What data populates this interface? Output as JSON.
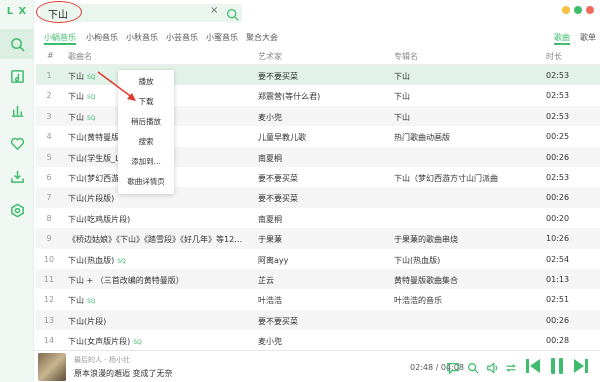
{
  "app": {
    "logo": "L X"
  },
  "search": {
    "query": "下山",
    "clear": "×"
  },
  "sources": [
    {
      "label": "小蜗音乐",
      "active": true
    },
    {
      "label": "小枸音乐",
      "active": false
    },
    {
      "label": "小秋音乐",
      "active": false
    },
    {
      "label": "小芸音乐",
      "active": false
    },
    {
      "label": "小蜜音乐",
      "active": false
    },
    {
      "label": "聚合大会",
      "active": false
    }
  ],
  "search_types": [
    {
      "label": "歌曲",
      "active": true
    },
    {
      "label": "歌单",
      "active": false
    }
  ],
  "table": {
    "headers": {
      "num": "#",
      "name": "歌曲名",
      "artist": "艺术家",
      "album": "专辑名",
      "time": "时长"
    },
    "rows": [
      {
        "num": "1",
        "name": "下山",
        "sq": "SQ",
        "artist": "要不要买菜",
        "album": "下山",
        "time": "02:53"
      },
      {
        "num": "2",
        "name": "下山",
        "sq": "SQ",
        "artist": "郑震营(等什么君)",
        "album": "下山",
        "time": "02:53"
      },
      {
        "num": "3",
        "name": "下山",
        "sq": "SQ",
        "artist": "麦小兜",
        "album": "下山",
        "time": "02:53"
      },
      {
        "num": "4",
        "name": "下山(黄特曼版)",
        "sq": "",
        "artist": "儿童早教儿歌",
        "album": "热门歌曲动画版",
        "time": "00:25"
      },
      {
        "num": "5",
        "name": "下山(学生版_Live)",
        "sq": "",
        "artist": "南夏桐",
        "album": "",
        "time": "00:26"
      },
      {
        "num": "6",
        "name": "下山(梦幻西游方寸山门派曲)",
        "sq": "",
        "artist": "要不要买菜",
        "album": "下山（梦幻西游方寸山门派曲",
        "time": "02:53"
      },
      {
        "num": "7",
        "name": "下山(片段版)",
        "sq": "",
        "artist": "要不要买菜",
        "album": "",
        "time": "00:26"
      },
      {
        "num": "8",
        "name": "下山(吃鸡版片段)",
        "sq": "",
        "artist": "南夏桐",
        "album": "",
        "time": "00:20"
      },
      {
        "num": "9",
        "name": "《桥边姑娘》《下山》《踏雪段》《好几年》等12首热歌串...",
        "sq": "",
        "artist": "于果蒹",
        "album": "于果蒹的歌曲串烧",
        "time": "10:26"
      },
      {
        "num": "10",
        "name": "下山(热血版)",
        "sq": "SQ",
        "artist": "阿离ayy",
        "album": "下山(热血版)",
        "time": "02:54"
      },
      {
        "num": "11",
        "name": "下山 + （三首改编的黄特曼版）",
        "sq": "",
        "artist": "芷云",
        "album": "黄特曼版歌曲集合",
        "time": "01:13"
      },
      {
        "num": "12",
        "name": "下山",
        "sq": "SQ",
        "artist": "叶浩浩",
        "album": "叶浩浩的音乐",
        "time": "02:51"
      },
      {
        "num": "13",
        "name": "下山(片段)",
        "sq": "",
        "artist": "要不要买菜",
        "album": "",
        "time": "00:26"
      },
      {
        "num": "14",
        "name": "下山(女声版片段)",
        "sq": "SQ",
        "artist": "麦小兜",
        "album": "",
        "time": "00:28"
      }
    ]
  },
  "context_menu": [
    "播放",
    "下载",
    "稍后播放",
    "搜索",
    "添加到...",
    "歌曲详情页"
  ],
  "player": {
    "title": "最后的人 - 杨小壮",
    "lyric": "原本浪漫的邂逅 变成了无奈",
    "current_time": "02:48",
    "separator": "/",
    "total_time": "04:08"
  },
  "colors": {
    "accent": "#3fbc6e",
    "annotation": "#e23a2f"
  }
}
